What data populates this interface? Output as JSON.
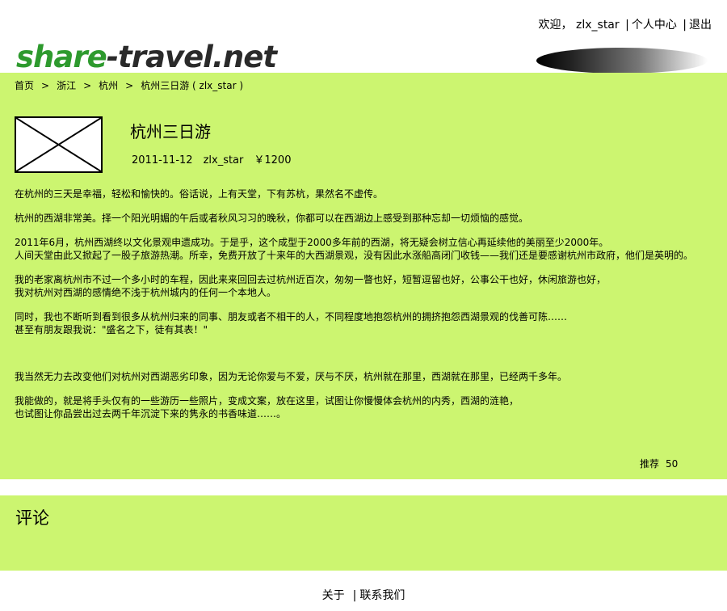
{
  "topbar": {
    "welcome": "欢迎，",
    "username": "zlx_star",
    "profile": "个人中心",
    "logout": "退出",
    "separator": "|"
  },
  "logo": {
    "part1": "share",
    "part2": "-travel.net"
  },
  "breadcrumb": {
    "items": [
      "首页",
      "浙江",
      "杭州",
      "杭州三日游 ( zlx_star )"
    ],
    "arrow": ">"
  },
  "post": {
    "title": "杭州三日游",
    "date": "2011-11-12",
    "author": "zlx_star",
    "price": "￥1200",
    "paragraphs": [
      [
        "在杭州的三天是幸福，轻松和愉快的。俗话说，上有天堂，下有苏杭，果然名不虚传。"
      ],
      [
        "杭州的西湖非常美。择一个阳光明媚的午后或者秋风习习的晚秋，你都可以在西湖边上感受到那种忘却一切烦恼的感觉。"
      ],
      [
        "2011年6月，杭州西湖终以文化景观申遗成功。于是乎，这个成型于2000多年前的西湖，将无疑会树立信心再延续他的美丽至少2000年。",
        "人间天堂由此又掀起了一股子旅游热潮。所幸，免费开放了十来年的大西湖景观，没有因此水涨船高闭门收钱——我们还是要感谢杭州市政府，他们是英明的。"
      ],
      [
        "我的老家离杭州市不过一个多小时的车程，因此来来回回去过杭州近百次，匆匆一瞥也好，短暂逗留也好，公事公干也好，休闲旅游也好，",
        "我对杭州对西湖的感情绝不浅于杭州城内的任何一个本地人。"
      ],
      [
        "同时，我也不断听到看到很多从杭州归来的同事、朋友或者不相干的人，不同程度地抱怨杭州的拥挤抱怨西湖景观的伐善可陈……",
        "甚至有朋友跟我说：\"盛名之下，徒有其表！\""
      ],
      [
        "我当然无力去改变他们对杭州对西湖恶劣印象，因为无论你爱与不爱，厌与不厌，杭州就在那里，西湖就在那里，已经两千多年。"
      ],
      [
        "我能做的，就是将手头仅有的一些游历一些照片，变成文案，放在这里，试图让你慢慢体会杭州的内秀，西湖的涟艳，",
        "也试图让你品尝出过去两千年沉淀下来的隽永的书香味道……。"
      ]
    ],
    "recommend_label": "推荐",
    "recommend_count": "50"
  },
  "comments": {
    "heading": "评论"
  },
  "footer": {
    "about": "关于",
    "contact": "联系我们",
    "separator": "|"
  },
  "colors": {
    "panel": "#ccf570",
    "logo_green": "#2e9a2e"
  }
}
